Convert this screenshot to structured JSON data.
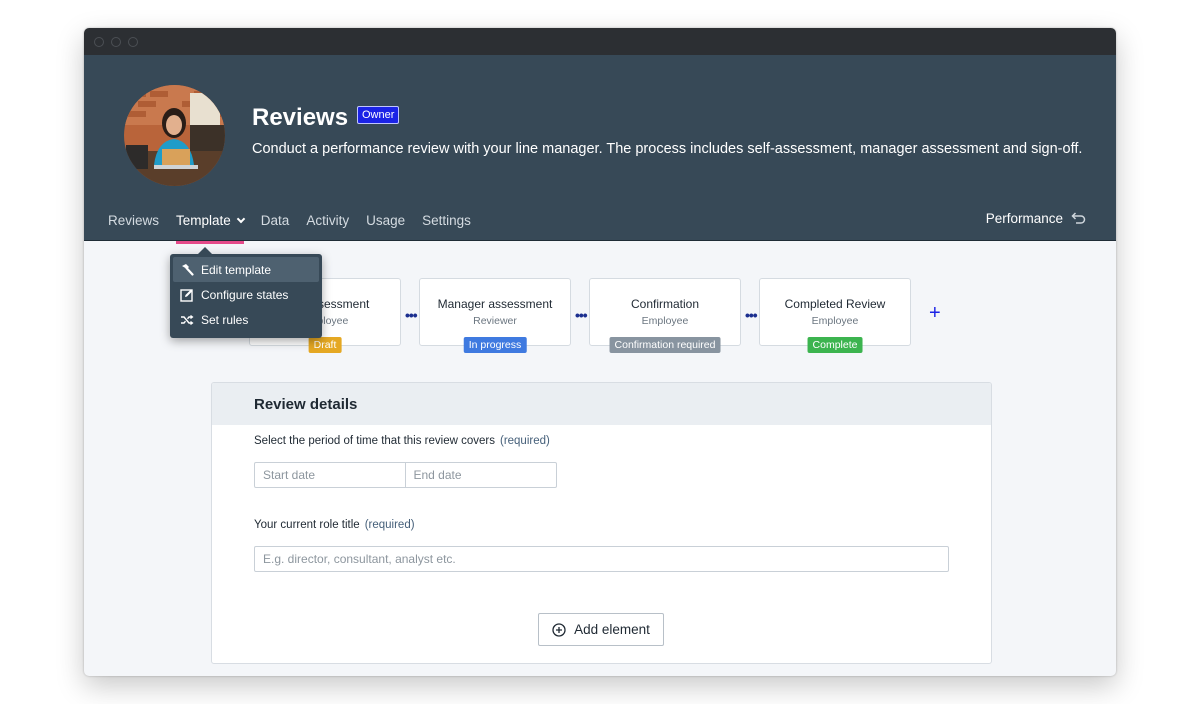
{
  "app": {
    "title": "Reviews",
    "owner_badge": "Owner",
    "description": "Conduct a performance review with your line manager. The process includes self-assessment, manager assessment and sign-off."
  },
  "tabs": [
    {
      "label": "Reviews"
    },
    {
      "label": "Template",
      "active": true
    },
    {
      "label": "Data"
    },
    {
      "label": "Activity"
    },
    {
      "label": "Usage"
    },
    {
      "label": "Settings"
    }
  ],
  "context_link": {
    "label": "Performance",
    "icon": "undo-arrow-icon"
  },
  "template_menu": {
    "items": [
      {
        "label": "Edit template",
        "icon": "hammer-icon",
        "highlighted": true
      },
      {
        "label": "Configure states",
        "icon": "edit-square-icon"
      },
      {
        "label": "Set rules",
        "icon": "shuffle-icon"
      }
    ]
  },
  "stages": [
    {
      "name": "Self-assessment",
      "role": "Employee",
      "status": "Draft",
      "status_color": "#e5a823"
    },
    {
      "name": "Manager assessment",
      "role": "Reviewer",
      "status": "In progress",
      "status_color": "#3f7ae0"
    },
    {
      "name": "Confirmation",
      "role": "Employee",
      "status": "Confirmation required",
      "status_color": "#8894a0"
    },
    {
      "name": "Completed Review",
      "role": "Employee",
      "status": "Complete",
      "status_color": "#3cb44f"
    }
  ],
  "stage_add_icon": "plus-icon",
  "section": {
    "title": "Review details",
    "period": {
      "label": "Select the period of time that this review covers",
      "required": "(required)",
      "start_placeholder": "Start date",
      "end_placeholder": "End date"
    },
    "role_title": {
      "label": "Your current role title",
      "required": "(required)",
      "placeholder": "E.g. director, consultant, analyst etc."
    },
    "add_button": "Add element"
  },
  "colors": {
    "header_bg": "#374957",
    "owner_badge": "#1b23e6",
    "active_tab_underline": "#e54a8a"
  }
}
